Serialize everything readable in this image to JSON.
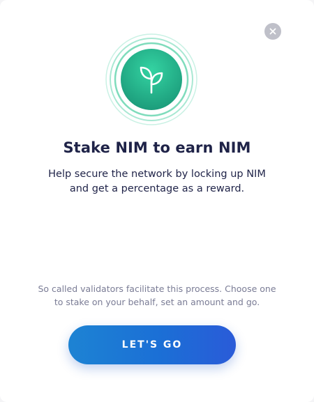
{
  "dialog": {
    "close_icon": "close-icon",
    "hero_icon": "sprout-icon",
    "title": "Stake NIM to earn NIM",
    "subtitle_line1": "Help secure the network by locking up NIM",
    "subtitle_line2": "and get a percentage as a reward.",
    "info_line1": "So called validators facilitate this process. Choose one",
    "info_line2": "to stake on your behalf, set an amount and go.",
    "cta_label": "LET'S GO"
  },
  "colors": {
    "title": "#1f2348",
    "info_text": "#7a7c95",
    "close_bg": "#bfc0c9",
    "hero_green_light": "#2fcf9c",
    "hero_green_dark": "#1c9c7a",
    "cta_start": "#1d83d3",
    "cta_end": "#2a5bd8"
  }
}
